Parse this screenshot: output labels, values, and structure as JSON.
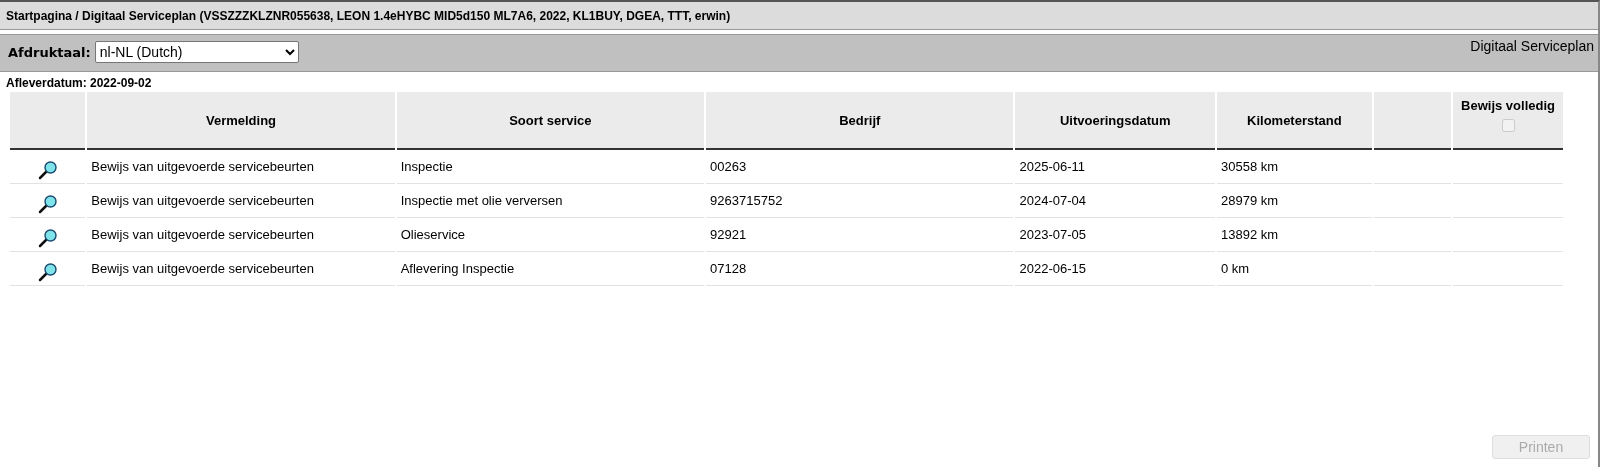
{
  "title": "Startpagina / Digitaal Serviceplan (VSSZZZKLZNR055638, LEON 1.4eHYBC MID5d150 ML7A6, 2022, KL1BUY, DGEA, TTT, erwin)",
  "toolbar": {
    "language_label": "Afdruktaal:",
    "language_value": "nl-NL (Dutch)",
    "section_title": "Digitaal Serviceplan"
  },
  "delivery_date": "Afleverdatum: 2022-09-02",
  "table": {
    "columns": [
      "Vermelding",
      "Soort service",
      "Bedrijf",
      "Uitvoeringsdatum",
      "Kilometerstand"
    ],
    "proof_column": {
      "label": "Bewijs volledig",
      "checked": false,
      "disabled": true
    },
    "rows": [
      {
        "entry": "Bewijs van uitgevoerde servicebeurten",
        "service": "Inspectie",
        "company": "00263",
        "date": "2025-06-11",
        "mileage": "30558 km"
      },
      {
        "entry": "Bewijs van uitgevoerde servicebeurten",
        "service": "Inspectie met olie verversen",
        "company": "9263715752",
        "date": "2024-07-04",
        "mileage": "28979 km"
      },
      {
        "entry": "Bewijs van uitgevoerde servicebeurten",
        "service": "Olieservice",
        "company": "92921",
        "date": "2023-07-05",
        "mileage": "13892 km"
      },
      {
        "entry": "Bewijs van uitgevoerde servicebeurten",
        "service": "Aflevering Inspectie",
        "company": "07128",
        "date": "2022-06-15",
        "mileage": "0 km"
      }
    ]
  },
  "print_button": {
    "label": "Printen",
    "disabled": true
  }
}
